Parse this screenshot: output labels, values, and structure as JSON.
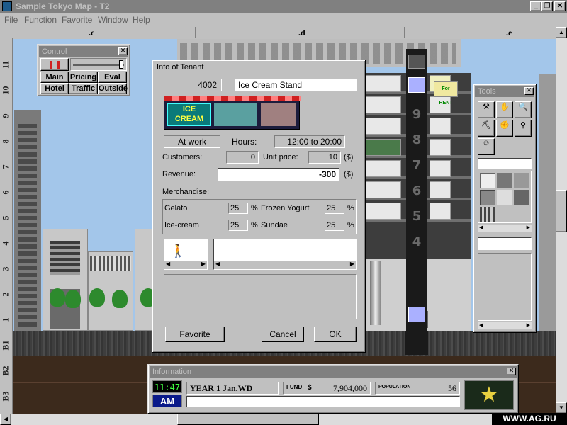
{
  "window": {
    "title": "Sample Tokyo Map - T2"
  },
  "menu": [
    "File",
    "Function",
    "Favorite",
    "Window",
    "Help"
  ],
  "ruler": {
    "columns": [
      ".c",
      ".d",
      ".e"
    ],
    "floors": [
      "11",
      "10",
      "9",
      "8",
      "7",
      "6",
      "5",
      "4",
      "3",
      "2",
      "1",
      "B1",
      "B2",
      "B3"
    ]
  },
  "tower_floor_numbers": [
    "9",
    "8",
    "7",
    "6",
    "5",
    "4"
  ],
  "for_rent_sign": "For RENT",
  "control": {
    "title": "Control",
    "buttons": [
      "Main",
      "Pricing",
      "Eval",
      "Hotel",
      "Traffic",
      "Outside"
    ]
  },
  "tools": {
    "title": "Tools"
  },
  "tenant": {
    "title": "Info of Tenant",
    "id": "4002",
    "name": "Ice Cream Stand",
    "sign": "ICE CREAM",
    "status": "At work",
    "hours_label": "Hours:",
    "hours": "12:00 to 20:00",
    "customers_label": "Customers:",
    "customers": "0",
    "unit_price_label": "Unit price:",
    "unit_price": "10",
    "currency": "($)",
    "revenue_label": "Revenue:",
    "revenue": "-300",
    "merchandise_label": "Merchandise:",
    "merch": [
      {
        "name": "Gelato",
        "pct": "25"
      },
      {
        "name": "Frozen Yogurt",
        "pct": "25"
      },
      {
        "name": "Ice-cream",
        "pct": "25"
      },
      {
        "name": "Sundae",
        "pct": "25"
      }
    ],
    "pct_sign": "%",
    "favorite_label": "Favorite",
    "cancel_label": "Cancel",
    "ok_label": "OK"
  },
  "information": {
    "title": "Information",
    "time": "11:47",
    "ampm": "AM",
    "date": "YEAR 1 Jan.WD",
    "fund_label": "FUND",
    "fund_currency": "$",
    "fund_value": "7,904,000",
    "population_label": "POPULATION",
    "population_value": "56"
  },
  "watermark": "WWW.AG.RU"
}
